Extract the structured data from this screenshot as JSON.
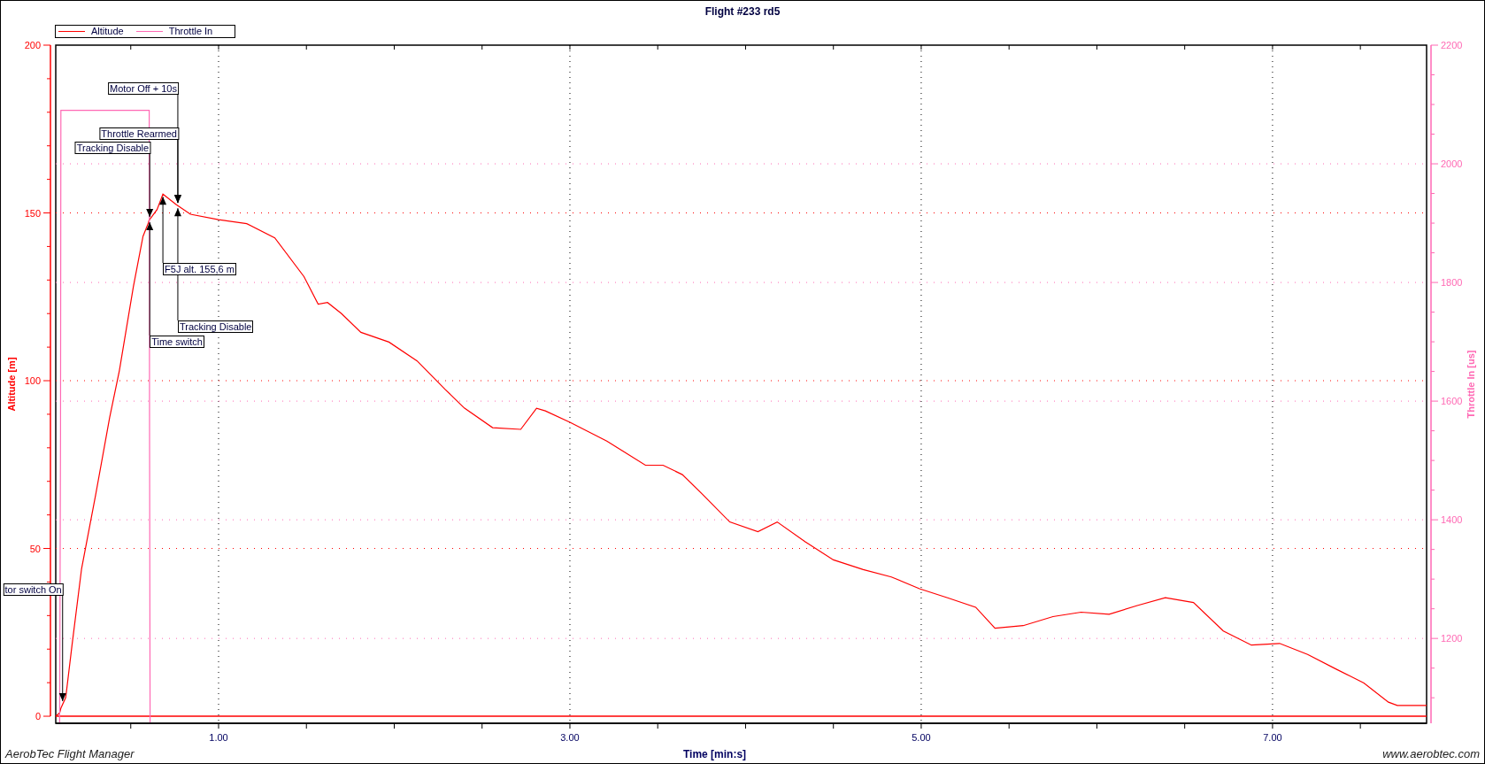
{
  "chart_data": {
    "type": "line",
    "title": "Flight #233 rd5",
    "xlabel": "Time [min:s]",
    "ylabel": "Altitude [m]",
    "y2label": "Throttle In [us]",
    "legend": "upper left",
    "grid": true,
    "x": [
      0.073,
      0.095,
      0.1,
      0.102,
      0.13,
      0.165,
      0.22,
      0.3,
      0.38,
      0.435,
      0.515,
      0.57,
      0.6,
      0.605,
      0.607,
      0.61,
      0.65,
      0.683,
      0.758,
      0.84,
      1.0,
      1.16,
      1.32,
      1.486,
      1.567,
      1.62,
      1.7,
      1.81,
      1.97,
      2.13,
      2.29,
      2.4,
      2.56,
      2.72,
      2.81,
      2.86,
      3.0,
      3.21,
      3.43,
      3.53,
      3.64,
      3.75,
      3.91,
      4.07,
      4.18,
      4.34,
      4.5,
      4.67,
      4.83,
      4.99,
      5.15,
      5.31,
      5.42,
      5.58,
      5.75,
      5.91,
      6.07,
      6.23,
      6.39,
      6.55,
      6.72,
      6.88,
      7.04,
      7.2,
      7.36,
      7.52,
      7.66,
      7.71,
      7.877
    ],
    "series": [
      {
        "name": "Altitude",
        "color": "#ff0000",
        "values": [
          0,
          1,
          2,
          2.4,
          5.6,
          21,
          44,
          66,
          89,
          103,
          128,
          143,
          147,
          148,
          148,
          148.2,
          151,
          155.6,
          152.5,
          149.6,
          148,
          146.8,
          142.6,
          131,
          122.8,
          123.3,
          120,
          114.4,
          111.5,
          105.9,
          97.4,
          91.8,
          86,
          85.5,
          91.8,
          91,
          87.6,
          82,
          74.8,
          74.8,
          72,
          66.4,
          57.9,
          55,
          57.9,
          52,
          46.6,
          43.7,
          41.5,
          38,
          35.3,
          32.5,
          26.2,
          27,
          29.7,
          31,
          30.4,
          33,
          35.3,
          33.9,
          25.4,
          21.2,
          21.7,
          18.4,
          14.1,
          9.9,
          4.2,
          3.2,
          3.2
        ]
      },
      {
        "name": "Throttle In",
        "color": "#ff69b4",
        "axis": "y2",
        "values": [
          null,
          1058,
          1550,
          2090,
          2090,
          2090,
          2090,
          2090,
          2090,
          2090,
          2090,
          2090,
          2090,
          2090,
          1550,
          1058,
          null,
          null,
          null,
          null,
          null,
          null,
          null,
          null,
          null,
          null,
          null,
          null,
          null,
          null,
          null,
          null,
          null,
          null,
          null,
          null,
          null,
          null,
          null,
          null,
          null,
          null,
          null,
          null,
          null,
          null,
          null,
          null,
          null,
          null,
          null,
          null,
          null,
          null,
          null,
          null,
          null,
          null,
          null,
          null,
          null,
          null,
          null,
          null,
          null,
          null,
          null,
          null,
          null
        ]
      }
    ],
    "xlim": [
      0.073,
      7.877
    ],
    "ylim": [
      -2.1,
      200
    ],
    "y2lim": [
      1057,
      2200
    ],
    "xticks": [
      {
        "value": 1,
        "label": "1.00"
      },
      {
        "value": 3,
        "label": "3.00"
      },
      {
        "value": 5,
        "label": "5.00"
      },
      {
        "value": 7,
        "label": "7.00"
      }
    ],
    "yticks": [
      {
        "value": 200,
        "label": "200"
      },
      {
        "value": 150,
        "label": "150"
      },
      {
        "value": 100,
        "label": "100"
      },
      {
        "value": 50,
        "label": "50"
      },
      {
        "value": 0,
        "label": "0"
      }
    ],
    "y2ticks": [
      {
        "value": 2200,
        "label": "2200"
      },
      {
        "value": 2000,
        "label": "2000"
      },
      {
        "value": 1800,
        "label": "1800"
      },
      {
        "value": 1600,
        "label": "1600"
      },
      {
        "value": 1400,
        "label": "1400"
      },
      {
        "value": 1200,
        "label": "1200"
      }
    ],
    "ref_lines": [
      {
        "axis": "y",
        "value": 0,
        "color": "#ff0000"
      }
    ],
    "annotations": [
      {
        "text": "tor switch On",
        "x": 0.112,
        "y": 3.7
      },
      {
        "text": "Tracking Disable",
        "x": 0.608,
        "y": 148
      },
      {
        "text": "Time switch",
        "x": 0.608,
        "y": 148
      },
      {
        "text": "Motor Off + 10s",
        "x": 0.768,
        "y": 152.2
      },
      {
        "text": "Throttle Rearmed",
        "x": 0.768,
        "y": 152.2
      },
      {
        "text": "Tracking Disable",
        "x": 0.768,
        "y": 152.2
      },
      {
        "text": "F5J alt. 155,6 m",
        "x": 0.683,
        "y": 155.6
      }
    ]
  },
  "footer": {
    "left": "AerobTec Flight Manager",
    "right": "www.aerobtec.com"
  }
}
